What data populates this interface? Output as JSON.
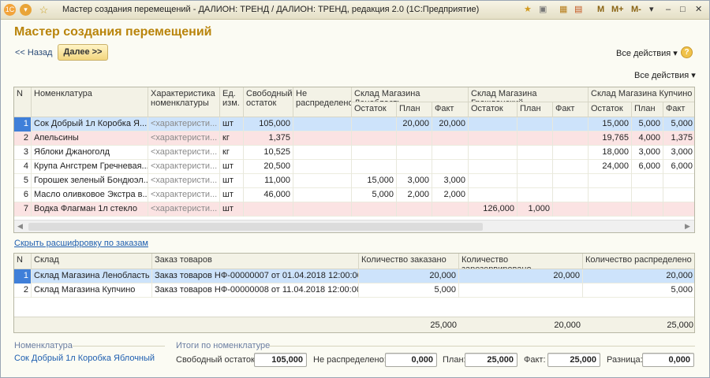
{
  "window": {
    "title": "Мастер создания перемещений - ДАЛИОН: ТРЕНД / ДАЛИОН: ТРЕНД, редакция 2.0  (1С:Предприятие)",
    "title_right": [
      "M",
      "M+",
      "M-"
    ]
  },
  "form": {
    "title": "Мастер создания перемещений",
    "back_label": "<< Назад",
    "next_label": "Далее >>",
    "all_actions": "Все действия ▾",
    "all_actions_table": "Все действия ▾",
    "help": "?"
  },
  "main_table": {
    "headers": {
      "n": "N",
      "item": "Номенклатура",
      "char": "Характеристика номенклатуры",
      "unit": "Ед. изм.",
      "free": "Свободный остаток",
      "undist": "Не распределено",
      "wh1": "Склад Магазина Ленобласть",
      "wh2": "Склад Магазина Гражданский",
      "wh3": "Склад Магазина Купчино",
      "sub": [
        "Остаток",
        "План",
        "Факт"
      ]
    },
    "rows": [
      {
        "n": "1",
        "item": "Сок Добрый 1л Коробка Я...",
        "char": "<характеристи...",
        "unit": "шт",
        "free": "105,000",
        "undist": "",
        "w1": [
          "",
          "20,000",
          "20,000"
        ],
        "w2": [
          "",
          "",
          ""
        ],
        "w3": [
          "15,000",
          "5,000",
          "5,000"
        ]
      },
      {
        "n": "2",
        "item": "Апельсины",
        "char": "<характеристи...",
        "unit": "кг",
        "free": "1,375",
        "undist": "",
        "w1": [
          "",
          "",
          ""
        ],
        "w2": [
          "",
          "",
          ""
        ],
        "w3": [
          "19,765",
          "4,000",
          "1,375"
        ]
      },
      {
        "n": "3",
        "item": "Яблоки Джаноголд",
        "char": "<характеристи...",
        "unit": "кг",
        "free": "10,525",
        "undist": "",
        "w1": [
          "",
          "",
          ""
        ],
        "w2": [
          "",
          "",
          ""
        ],
        "w3": [
          "18,000",
          "3,000",
          "3,000"
        ]
      },
      {
        "n": "4",
        "item": "Крупа Ангстрем Гречневая...",
        "char": "<характеристи...",
        "unit": "шт",
        "free": "20,500",
        "undist": "",
        "w1": [
          "",
          "",
          ""
        ],
        "w2": [
          "",
          "",
          ""
        ],
        "w3": [
          "24,000",
          "6,000",
          "6,000"
        ]
      },
      {
        "n": "5",
        "item": "Горошек зеленый Бондюэл...",
        "char": "<характеристи...",
        "unit": "шт",
        "free": "11,000",
        "undist": "",
        "w1": [
          "15,000",
          "3,000",
          "3,000"
        ],
        "w2": [
          "",
          "",
          ""
        ],
        "w3": [
          "",
          "",
          ""
        ]
      },
      {
        "n": "6",
        "item": "Масло оливковое Экстра в...",
        "char": "<характеристи...",
        "unit": "шт",
        "free": "46,000",
        "undist": "",
        "w1": [
          "5,000",
          "2,000",
          "2,000"
        ],
        "w2": [
          "",
          "",
          ""
        ],
        "w3": [
          "",
          "",
          ""
        ]
      },
      {
        "n": "7",
        "item": "Водка Флагман 1л стекло",
        "char": "<характеристи...",
        "unit": "шт",
        "free": "",
        "undist": "",
        "w1": [
          "",
          "",
          ""
        ],
        "w2": [
          "126,000",
          "1,000",
          ""
        ],
        "w3": [
          "",
          "",
          ""
        ]
      }
    ]
  },
  "hide_link": "Скрыть расшифровку по заказам",
  "orders_table": {
    "headers": {
      "n": "N",
      "wh": "Склад",
      "order": "Заказ товаров",
      "ordered": "Количество заказано",
      "reserved": "Количество зарезервировано",
      "dist": "Количество распределено"
    },
    "rows": [
      {
        "n": "1",
        "wh": "Склад Магазина Ленобласть",
        "order": "Заказ товаров НФ-00000007 от 01.04.2018 12:00:00",
        "ordered": "20,000",
        "reserved": "20,000",
        "dist": "20,000"
      },
      {
        "n": "2",
        "wh": "Склад Магазина Купчино",
        "order": "Заказ товаров НФ-00000008 от 11.04.2018 12:00:00",
        "ordered": "5,000",
        "reserved": "",
        "dist": "5,000"
      }
    ],
    "totals": {
      "ordered": "25,000",
      "reserved": "20,000",
      "dist": "25,000"
    }
  },
  "footer": {
    "nom_label": "Номенклатура",
    "nom_value": "Сок Добрый 1л Коробка Яблочный",
    "totals_label": "Итоги по номенклатуре",
    "free_label": "Свободный остаток:",
    "free_value": "105,000",
    "undist_label": "Не распределено:",
    "undist_value": "0,000",
    "plan_label": "План:",
    "plan_value": "25,000",
    "fact_label": "Факт:",
    "fact_value": "25,000",
    "diff_label": "Разница:",
    "diff_value": "0,000"
  },
  "colors": {
    "selected_row": "#cde3fb",
    "pink_row": "#fbe3e3",
    "accent": "#b9840b"
  }
}
